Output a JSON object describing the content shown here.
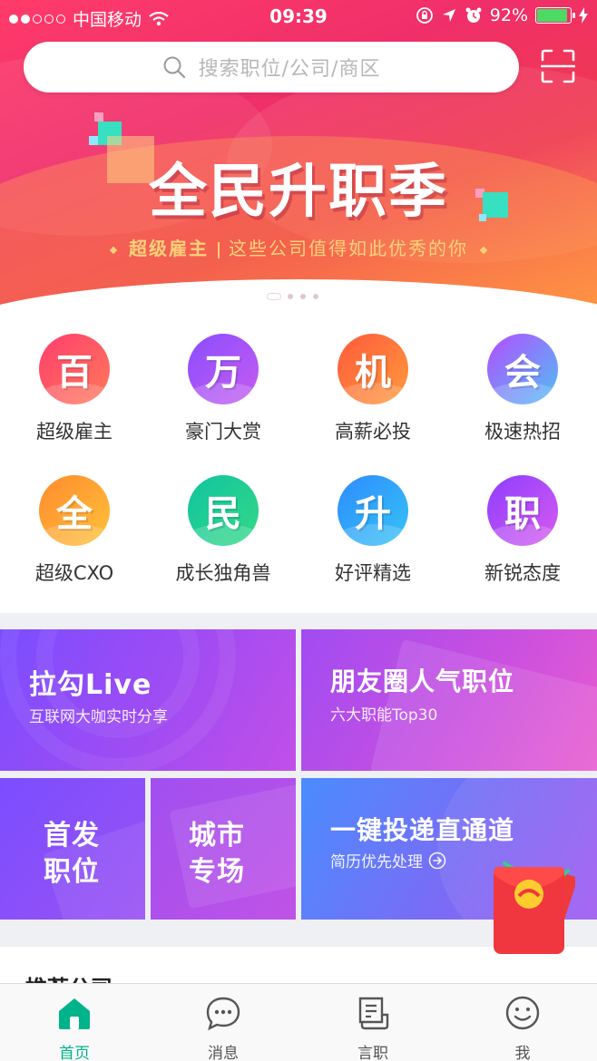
{
  "status_bar": {
    "carrier": "中国移动",
    "time": "09:39",
    "battery": "92%",
    "battery_level": 0.92
  },
  "search": {
    "placeholder": "搜索职位/公司/商区"
  },
  "banner": {
    "title": "全民升职季",
    "subtitle_bold": "超级雇主",
    "subtitle_rest": "这些公司值得如此优秀的你",
    "pages": 4,
    "active_page": 1
  },
  "categories": [
    {
      "glyph": "百",
      "label": "超级雇主",
      "color_a": "#ff3d6e",
      "color_b": "#ff7a59"
    },
    {
      "glyph": "万",
      "label": "豪门大赏",
      "color_a": "#8a4dff",
      "color_b": "#c65cf0"
    },
    {
      "glyph": "机",
      "label": "高薪必投",
      "color_a": "#ff5a3c",
      "color_b": "#ff9a3c"
    },
    {
      "glyph": "会",
      "label": "极速热招",
      "color_a": "#b44dff",
      "color_b": "#4fc0f5"
    },
    {
      "glyph": "全",
      "label": "超级CXO",
      "color_a": "#ff8a2e",
      "color_b": "#ffc23a"
    },
    {
      "glyph": "民",
      "label": "成长独角兽",
      "color_a": "#10c4a0",
      "color_b": "#34d886"
    },
    {
      "glyph": "升",
      "label": "好评精选",
      "color_a": "#2e8bff",
      "color_b": "#36c3f5"
    },
    {
      "glyph": "职",
      "label": "新锐态度",
      "color_a": "#8c3dff",
      "color_b": "#d85bf0"
    }
  ],
  "promos": {
    "live": {
      "title": "拉勾Live",
      "subtitle": "互联网大咖实时分享"
    },
    "moments": {
      "title": "朋友圈人气职位",
      "subtitle": "六大职能Top30"
    },
    "first": {
      "line1": "首发",
      "line2": "职位"
    },
    "city": {
      "line1": "城市",
      "line2": "专场"
    },
    "oneclick": {
      "title": "一键投递直通道",
      "subtitle": "简历优先处理"
    }
  },
  "recommend": {
    "heading": "推荐公司"
  },
  "tabbar": [
    {
      "label": "首页",
      "icon": "home-icon",
      "active": true
    },
    {
      "label": "消息",
      "icon": "message-icon",
      "active": false
    },
    {
      "label": "言职",
      "icon": "document-icon",
      "active": false
    },
    {
      "label": "我",
      "icon": "profile-icon",
      "active": false
    }
  ],
  "colors": {
    "accent": "#00b38a",
    "banner_gold": "#ffd27a"
  }
}
